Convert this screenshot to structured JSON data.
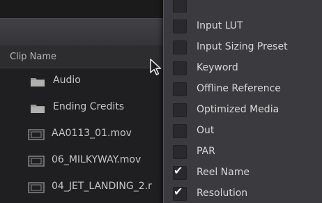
{
  "list": {
    "header_label": "Clip Name",
    "rows": [
      {
        "kind": "folder",
        "name": "Audio",
        "icon": "folder-icon"
      },
      {
        "kind": "folder",
        "name": "Ending Credits",
        "icon": "folder-icon"
      },
      {
        "kind": "file",
        "name": "AA0113_01.mov",
        "icon": "video-clip-icon"
      },
      {
        "kind": "file",
        "name": "06_MILKYWAY.mov",
        "icon": "video-clip-icon"
      },
      {
        "kind": "file",
        "name": "04_JET_LANDING_2.r",
        "icon": "video-clip-icon"
      }
    ]
  },
  "column_menu": {
    "items": [
      {
        "label": "",
        "checked": false
      },
      {
        "label": "Input LUT",
        "checked": false
      },
      {
        "label": "Input Sizing Preset",
        "checked": false
      },
      {
        "label": "Keyword",
        "checked": false
      },
      {
        "label": "Offline Reference",
        "checked": false
      },
      {
        "label": "Optimized Media",
        "checked": false
      },
      {
        "label": "Out",
        "checked": false
      },
      {
        "label": "PAR",
        "checked": false
      },
      {
        "label": "Reel Name",
        "checked": true
      },
      {
        "label": "Resolution",
        "checked": true
      }
    ]
  },
  "colors": {
    "background": "#1f1f21",
    "menu_background": "#3b3b3f",
    "text": "#d8d8d8",
    "check": "#f2f2f2"
  }
}
